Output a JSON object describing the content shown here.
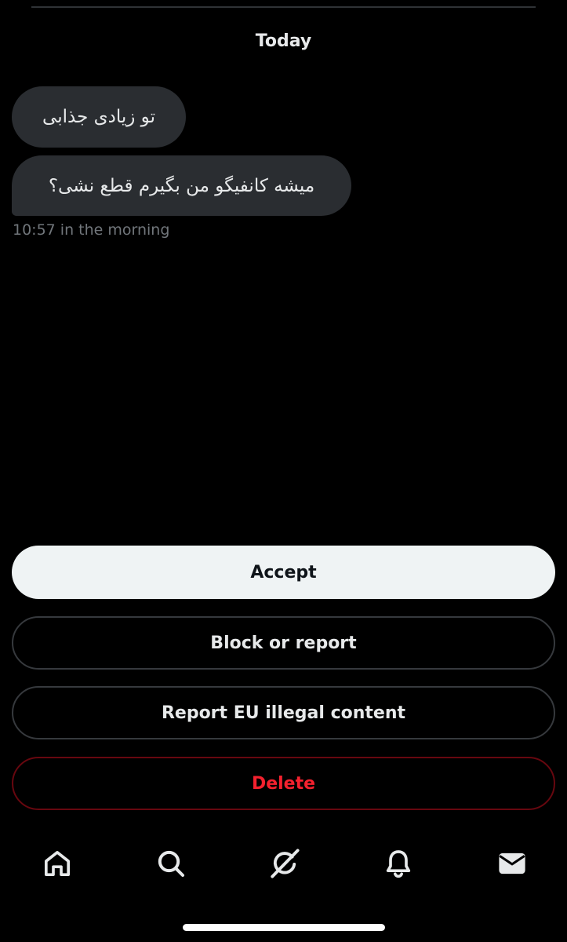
{
  "conversation": {
    "date_header": "Today",
    "messages": [
      {
        "text": "تو زیادی جذابی"
      },
      {
        "text": "میشه کانفیگو من بگیرم قطع نشی؟"
      }
    ],
    "timestamp": "10:57 in the morning"
  },
  "actions": {
    "accept_label": "Accept",
    "block_label": "Block or report",
    "report_eu_label": "Report EU illegal content",
    "delete_label": "Delete"
  },
  "bottom_nav": {
    "icons": [
      "home-icon",
      "search-icon",
      "grok-icon",
      "notifications-bell-icon",
      "messages-envelope-icon"
    ]
  },
  "colors": {
    "background": "#000000",
    "bubble": "#2a2d31",
    "accept_bg": "#eff3f4",
    "delete_text": "#f4212e",
    "secondary_text": "#71767b"
  }
}
